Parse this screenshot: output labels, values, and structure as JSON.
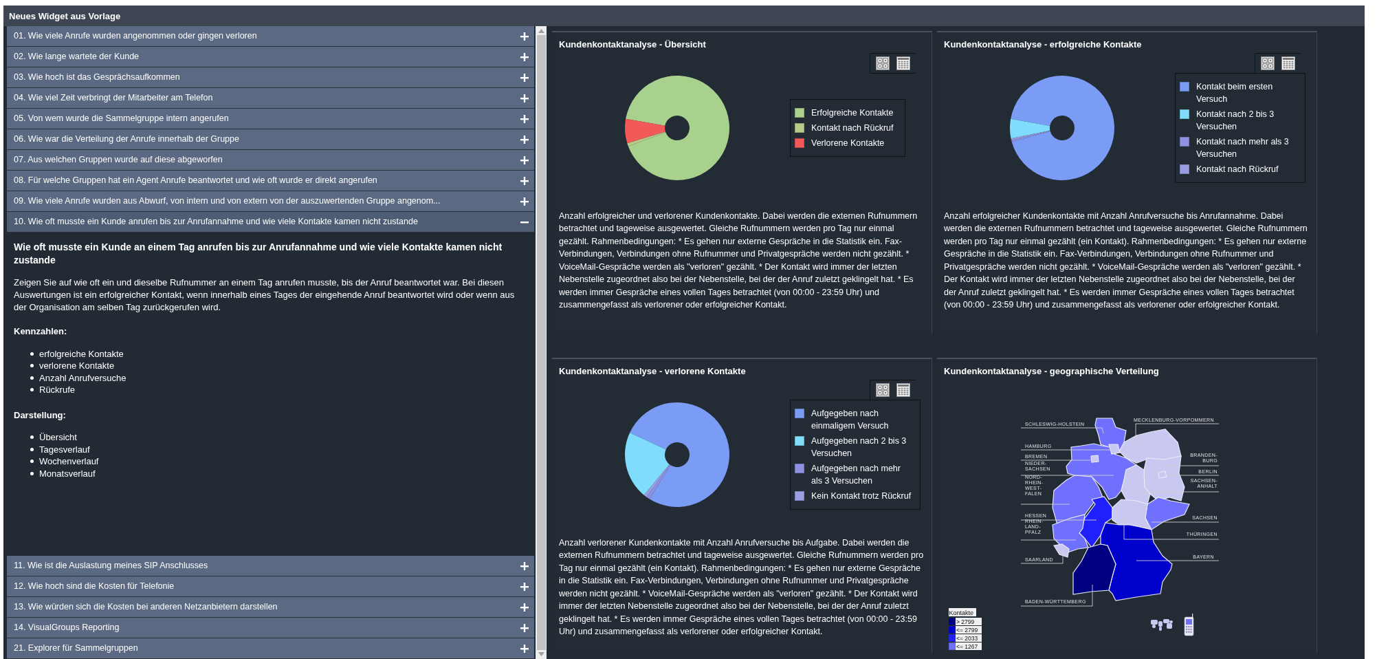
{
  "window": {
    "title": "Neues Widget aus Vorlage"
  },
  "questions": [
    {
      "label": "01. Wie viele Anrufe wurden angenommen oder gingen verloren",
      "expanded": false
    },
    {
      "label": "02. Wie lange wartete der Kunde",
      "expanded": false
    },
    {
      "label": "03. Wie hoch ist das Gesprächsaufkommen",
      "expanded": false
    },
    {
      "label": "04. Wie viel Zeit verbringt der Mitarbeiter am Telefon",
      "expanded": false
    },
    {
      "label": "05. Von wem wurde die Sammelgruppe intern angerufen",
      "expanded": false
    },
    {
      "label": "06. Wie war die Verteilung der Anrufe innerhalb der Gruppe",
      "expanded": false
    },
    {
      "label": "07. Aus welchen Gruppen wurde auf diese abgeworfen",
      "expanded": false
    },
    {
      "label": "08. Für welche Gruppen hat ein Agent Anrufe beantwortet und wie oft wurde er direkt angerufen",
      "expanded": false
    },
    {
      "label": "09. Wie viele Anrufe wurden aus Abwurf, von intern und von extern von der auszuwertenden Gruppe angenom...",
      "expanded": false
    },
    {
      "label": "10. Wie oft musste ein Kunde anrufen bis zur Anrufannahme und wie viele Kontakte kamen nicht zustande",
      "expanded": true,
      "details": {
        "heading": "Wie oft musste ein Kunde an einem Tag anrufen bis zur Anrufannahme und wie viele Kontakte kamen nicht zustande",
        "text": "Zeigen Sie auf wie oft ein und dieselbe Rufnummer an einem Tag anrufen musste, bis der Anruf beantwortet war. Bei diesen Auswertungen ist ein erfolgreicher Kontakt, wenn innerhalb eines Tages der eingehende Anruf beantwortet wird oder wenn aus der Organisation am selben Tag zurückgerufen wird.",
        "sections": [
          {
            "title": "Kennzahlen:",
            "items": [
              "erfolgreiche Kontakte",
              "verlorene Kontakte",
              "Anzahl Anrufversuche",
              "Rückrufe"
            ]
          },
          {
            "title": "Darstellung:",
            "items": [
              "Übersicht",
              "Tagesverlauf",
              "Wochenverlauf",
              "Monatsverlauf"
            ]
          }
        ]
      }
    },
    {
      "label": "11. Wie ist die Auslastung meines SIP Anschlusses",
      "expanded": false
    },
    {
      "label": "12. Wie hoch sind die Kosten für Telefonie",
      "expanded": false
    },
    {
      "label": "13. Wie würden sich die Kosten bei anderen Netzanbietern darstellen",
      "expanded": false
    },
    {
      "label": "14. VisualGroups Reporting",
      "expanded": false
    },
    {
      "label": "21. Explorer für Sammelgruppen",
      "expanded": false
    }
  ],
  "charts": [
    {
      "kind": "donut",
      "title": "Kundenkontaktanalyse - Übersicht",
      "legend": [
        {
          "label": "Erfolgreiche Kontakte",
          "color": "#a9d18e"
        },
        {
          "label": "Kontakt nach Rückruf",
          "color": "#b8c98a"
        },
        {
          "label": "Verlorene Kontakte",
          "color": "#f25a5a"
        }
      ],
      "description": "Anzahl erfolgreicher und verlorener Kundenkontakte. Dabei werden die externen Rufnummern betrachtet und tageweise ausgewertet. Gleiche Rufnummern werden pro Tag nur einmal gezählt. Rahmenbedingungen: * Es gehen nur externe Gespräche in die Statistik ein. Fax-Verbindungen, Verbindungen ohne Rufnummer und Privatgespräche werden nicht gezählt. * VoiceMail-Gespräche werden als \"verloren\" gezählt. * Der Kontakt wird immer der letzten Nebenstelle zugeordnet also bei der Nebenstelle, bei der der Anruf zuletzt geklingelt hat. * Es werden immer Gespräche eines vollen Tages betrachtet (von 00:00 - 23:59 Uhr) und zusammengefasst als verlorener oder erfolgreicher Kontakt."
    },
    {
      "kind": "donut",
      "title": "Kundenkontaktanalyse - erfolgreiche Kontakte",
      "legend": [
        {
          "label": "Kontakt beim ersten Versuch",
          "color": "#7b9cf5"
        },
        {
          "label": "Kontakt nach 2 bis 3 Versuchen",
          "color": "#7fdcfb"
        },
        {
          "label": "Kontakt nach mehr als 3 Versuchen",
          "color": "#8e92e0"
        },
        {
          "label": "Kontakt nach Rückruf",
          "color": "#999ee2"
        }
      ],
      "description": "Anzahl erfolgreicher Kundenkontakte mit Anzahl Anrufversuche bis Anrufannahme. Dabei werden die externen Rufnummern betrachtet und tageweise ausgewertet. Gleiche Rufnummern werden pro Tag nur einmal gezählt (ein Kontakt). Rahmenbedingungen: * Es gehen nur externe Gespräche in die Statistik ein. Fax-Verbindungen, Verbindungen ohne Rufnummer und Privatgespräche werden nicht gezählt. * VoiceMail-Gespräche werden als \"verloren\" gezählt. * Der Kontakt wird immer der letzten Nebenstelle zugeordnet also bei der Nebenstelle, bei der der Anruf zuletzt geklingelt hat. * Es werden immer Gespräche eines vollen Tages betrachtet (von 00:00 - 23:59 Uhr) und zusammengefasst als verlorener oder erfolgreicher Kontakt."
    },
    {
      "kind": "donut",
      "title": "Kundenkontaktanalyse - verlorene Kontakte",
      "legend": [
        {
          "label": "Aufgegeben nach einmaligem Versuch",
          "color": "#7b9cf5"
        },
        {
          "label": "Aufgegeben nach 2 bis 3 Versuchen",
          "color": "#7fdcfb"
        },
        {
          "label": "Aufgegeben nach mehr als 3 Versuchen",
          "color": "#8e92e0"
        },
        {
          "label": "Kein Kontakt trotz Rückruf",
          "color": "#999ee2"
        }
      ],
      "description": "Anzahl verlorener Kundenkontakte mit Anzahl Anrufversuche bis Aufgabe. Dabei werden die externen Rufnummern betrachtet und tageweise ausgewertet. Gleiche Rufnummern werden pro Tag nur einmal gezählt (ein Kontakt). Rahmenbedingungen: * Es gehen nur externe Gespräche in die Statistik ein. Fax-Verbindungen, Verbindungen ohne Rufnummer und Privatgespräche werden nicht gezählt. * VoiceMail-Gespräche werden als \"verloren\" gezählt. * Der Kontakt wird immer der letzten Nebenstelle zugeordnet also bei der Nebenstelle, bei der der Anruf zuletzt geklingelt hat. * Es werden immer Gespräche eines vollen Tages betrachtet (von 00:00 - 23:59 Uhr) und zusammengefasst als verlorener oder erfolgreicher Kontakt."
    },
    {
      "kind": "map",
      "title": "Kundenkontaktanalyse - geographische Verteilung",
      "regions": [
        {
          "lines": [
            "MECKLENBURG-VORPOMMERN"
          ],
          "color": "#c8c8f0"
        },
        {
          "lines": [
            "SCHLESWIG-HOLSTEIN"
          ],
          "color": "#7070ff"
        },
        {
          "lines": [
            "HAMBURG"
          ],
          "color": "#c8c8f0"
        },
        {
          "lines": [
            "BREMEN"
          ],
          "color": "#c8c8f0"
        },
        {
          "lines": [
            "NIEDER-",
            "SACHSEN"
          ],
          "color": "#7070ff"
        },
        {
          "lines": [
            "BRANDEN-",
            "BURG"
          ],
          "color": "#c8c8f0"
        },
        {
          "lines": [
            "BERLIN"
          ],
          "color": "#c8c8f0"
        },
        {
          "lines": [
            "NORD-",
            "RHEIN-",
            "WEST-",
            "FALEN"
          ],
          "color": "#7070ff"
        },
        {
          "lines": [
            "SACHSEN-",
            "ANHALT"
          ],
          "color": "#c8c8f0"
        },
        {
          "lines": [
            "HESSEN"
          ],
          "color": "#2020ff"
        },
        {
          "lines": [
            "RHEIN-",
            "LAND-",
            "PFALZ"
          ],
          "color": "#7070ff"
        },
        {
          "lines": [
            "SACHSEN"
          ],
          "color": "#7070ff"
        },
        {
          "lines": [
            "THÜRINGEN"
          ],
          "color": "#c8c8f0"
        },
        {
          "lines": [
            "SAARLAND"
          ],
          "color": "#c8c8f0"
        },
        {
          "lines": [
            "BAYERN"
          ],
          "color": "#0000cc"
        },
        {
          "lines": [
            "BADEN-WÜRTTEMBERG"
          ],
          "color": "#000080"
        }
      ],
      "map_legend": {
        "title": "Kontakte",
        "items": [
          {
            "label": ">   2799",
            "color": "#000080"
          },
          {
            "label": "<= 2799",
            "color": "#0000cc"
          },
          {
            "label": "<= 2033",
            "color": "#2020ff"
          },
          {
            "label": "<= 1267",
            "color": "#7070ff"
          }
        ]
      }
    }
  ]
}
